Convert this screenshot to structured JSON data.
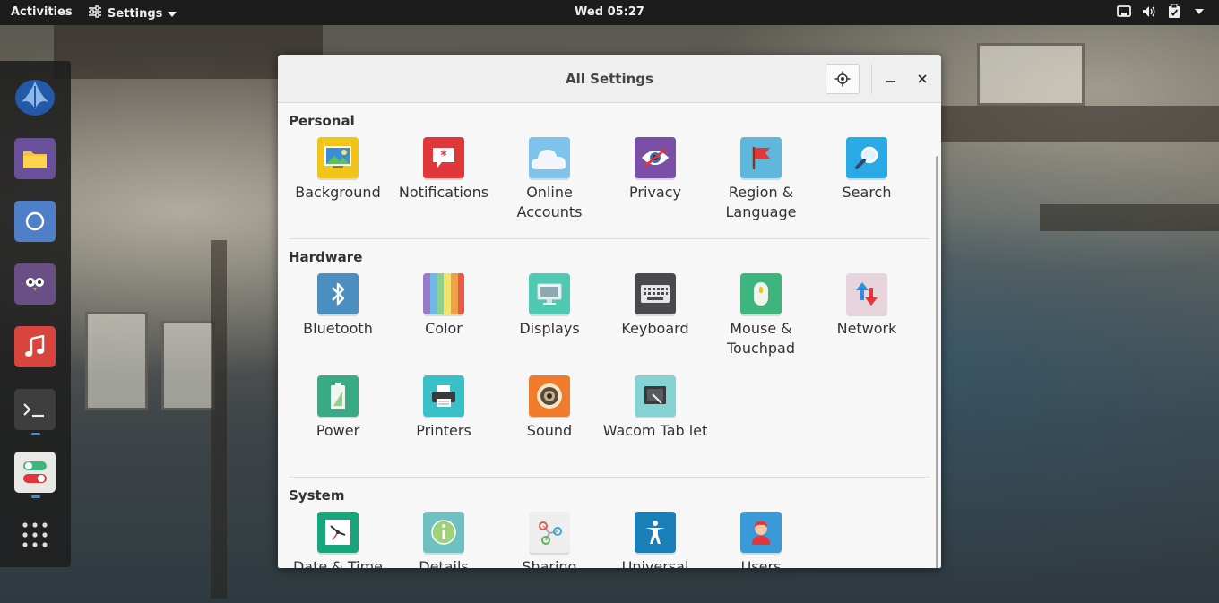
{
  "topbar": {
    "activities": "Activities",
    "app_menu": "Settings",
    "clock": "Wed 05:27"
  },
  "dock": {
    "items": [
      {
        "icon": "elementary-logo-icon",
        "color": "#2b5fa8"
      },
      {
        "icon": "files-icon",
        "color": "#6a4f9a"
      },
      {
        "icon": "chromium-icon",
        "color": "#4e7fc8"
      },
      {
        "icon": "corebird-icon",
        "color": "#6a4f86"
      },
      {
        "icon": "music-icon",
        "color": "#d8443e"
      },
      {
        "icon": "terminal-icon",
        "color": "#3e3e3e"
      },
      {
        "icon": "settings-switches-icon",
        "color": "#e8e8e4"
      },
      {
        "icon": "app-grid-icon",
        "color": "transparent"
      }
    ]
  },
  "window": {
    "title": "All Settings"
  },
  "sections": {
    "personal": {
      "title": "Personal",
      "items": [
        {
          "label": "Background",
          "icon": "background-icon",
          "color": "#f0c419"
        },
        {
          "label": "Notifications",
          "icon": "notifications-icon",
          "color": "#e0373b"
        },
        {
          "label": "Online Accounts",
          "icon": "online-accounts-icon",
          "color": "#7fc3ec"
        },
        {
          "label": "Privacy",
          "icon": "privacy-icon",
          "color": "#7a4fa8"
        },
        {
          "label": "Region & Language",
          "icon": "region-icon",
          "color": "#5fb8dc"
        },
        {
          "label": "Search",
          "icon": "search-icon",
          "color": "#29a9e6"
        }
      ]
    },
    "hardware": {
      "title": "Hardware",
      "items": [
        {
          "label": "Bluetooth",
          "icon": "bluetooth-icon",
          "color": "#4a8fc0"
        },
        {
          "label": "Color",
          "icon": "color-icon",
          "color": "#e8a14a"
        },
        {
          "label": "Displays",
          "icon": "displays-icon",
          "color": "#4fc9b2"
        },
        {
          "label": "Keyboard",
          "icon": "keyboard-icon",
          "color": "#4a4a4e"
        },
        {
          "label": "Mouse & Touchpad",
          "icon": "mouse-icon",
          "color": "#3fb57e"
        },
        {
          "label": "Network",
          "icon": "network-icon",
          "color": "#e8d4dc"
        },
        {
          "label": "Power",
          "icon": "power-icon",
          "color": "#3aa986"
        },
        {
          "label": "Printers",
          "icon": "printers-icon",
          "color": "#39bfc6"
        },
        {
          "label": "Sound",
          "icon": "sound-icon",
          "color": "#f07b2a"
        },
        {
          "label": "Wacom Tab let",
          "icon": "wacom-icon",
          "color": "#84d2d2"
        }
      ]
    },
    "system": {
      "title": "System",
      "items": [
        {
          "label": "Date & Time",
          "icon": "date-time-icon",
          "color": "#19a57c"
        },
        {
          "label": "Details",
          "icon": "details-icon",
          "color": "#6fc0c0"
        },
        {
          "label": "Sharing",
          "icon": "sharing-icon",
          "color": "#eeeeee"
        },
        {
          "label": "Universal",
          "icon": "universal-access-icon",
          "color": "#1a7fb8"
        },
        {
          "label": "Users",
          "icon": "users-icon",
          "color": "#3a9ad8"
        }
      ]
    }
  }
}
